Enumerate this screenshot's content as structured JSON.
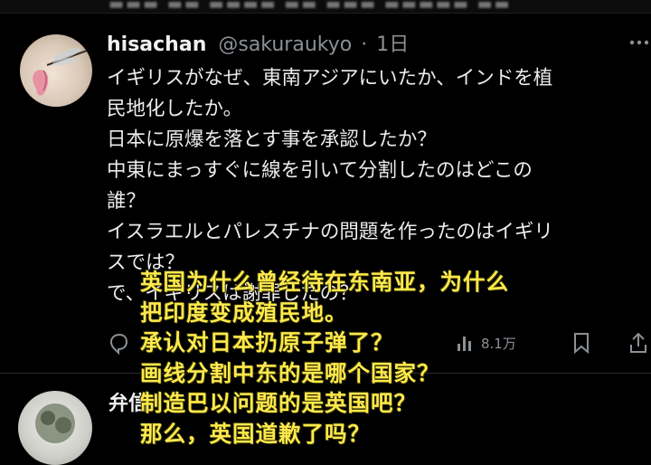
{
  "tweet": {
    "display_name": "hisachan",
    "handle": "@sakuraukyo",
    "separator": "·",
    "time": "1日",
    "lines": [
      "イギリスがなぜ、東南アジアにいたか、インドを植",
      "民地化したか。",
      "日本に原爆を落とす事を承認したか？",
      "中東にまっすぐに線を引いて分割したのはどこの",
      "誰？",
      "イスラエルとパレスチナの問題を作ったのはイギリ",
      "スでは？",
      "で、イギリスは謝罪したの？"
    ],
    "views_count": "8.1万"
  },
  "overlay_caption": {
    "lines": [
      "英国为什么曾经待在东南亚，为什么",
      "把印度变成殖民地。",
      "承认对日本扔原子弹了？",
      "画线分割中东的是哪个国家？",
      "制造巴以问题的是英国吧？",
      "那么，英国道歉了吗？"
    ],
    "color": "#ffe94d"
  },
  "reply": {
    "display_name": "弁信"
  },
  "icons": {
    "more": "more-icon",
    "reply": "reply-icon",
    "views": "views-icon",
    "bookmark": "bookmark-icon",
    "share": "share-icon"
  },
  "colors": {
    "background": "#000000",
    "text": "#e7e9ea",
    "secondary": "#8b9096"
  }
}
